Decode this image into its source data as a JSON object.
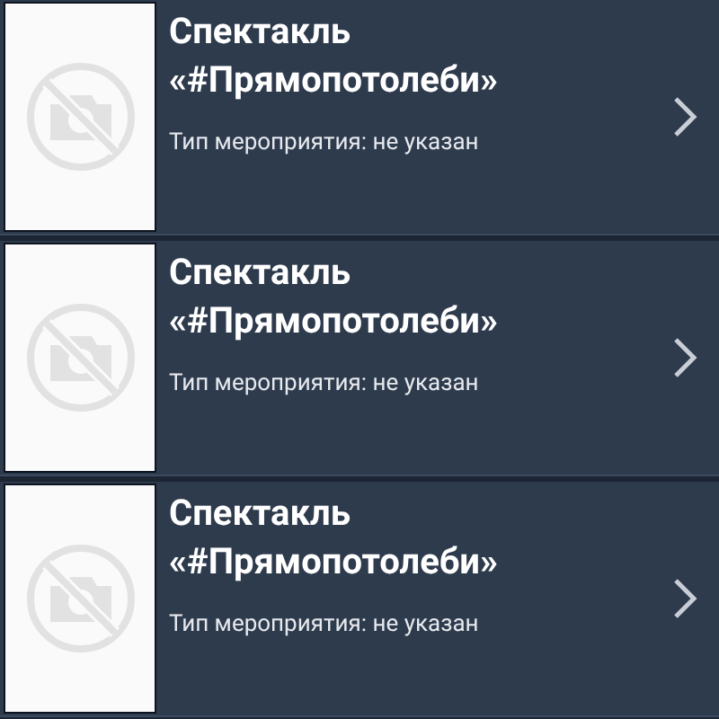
{
  "events": [
    {
      "title": "Спектакль «#Прямопотолеби»",
      "type_label": "Тип мероприятия: не указан"
    },
    {
      "title": "Спектакль «#Прямопотолеби»",
      "type_label": "Тип мероприятия: не указан"
    },
    {
      "title": "Спектакль «#Прямопотолеби»",
      "type_label": "Тип мероприятия: не указан"
    }
  ]
}
